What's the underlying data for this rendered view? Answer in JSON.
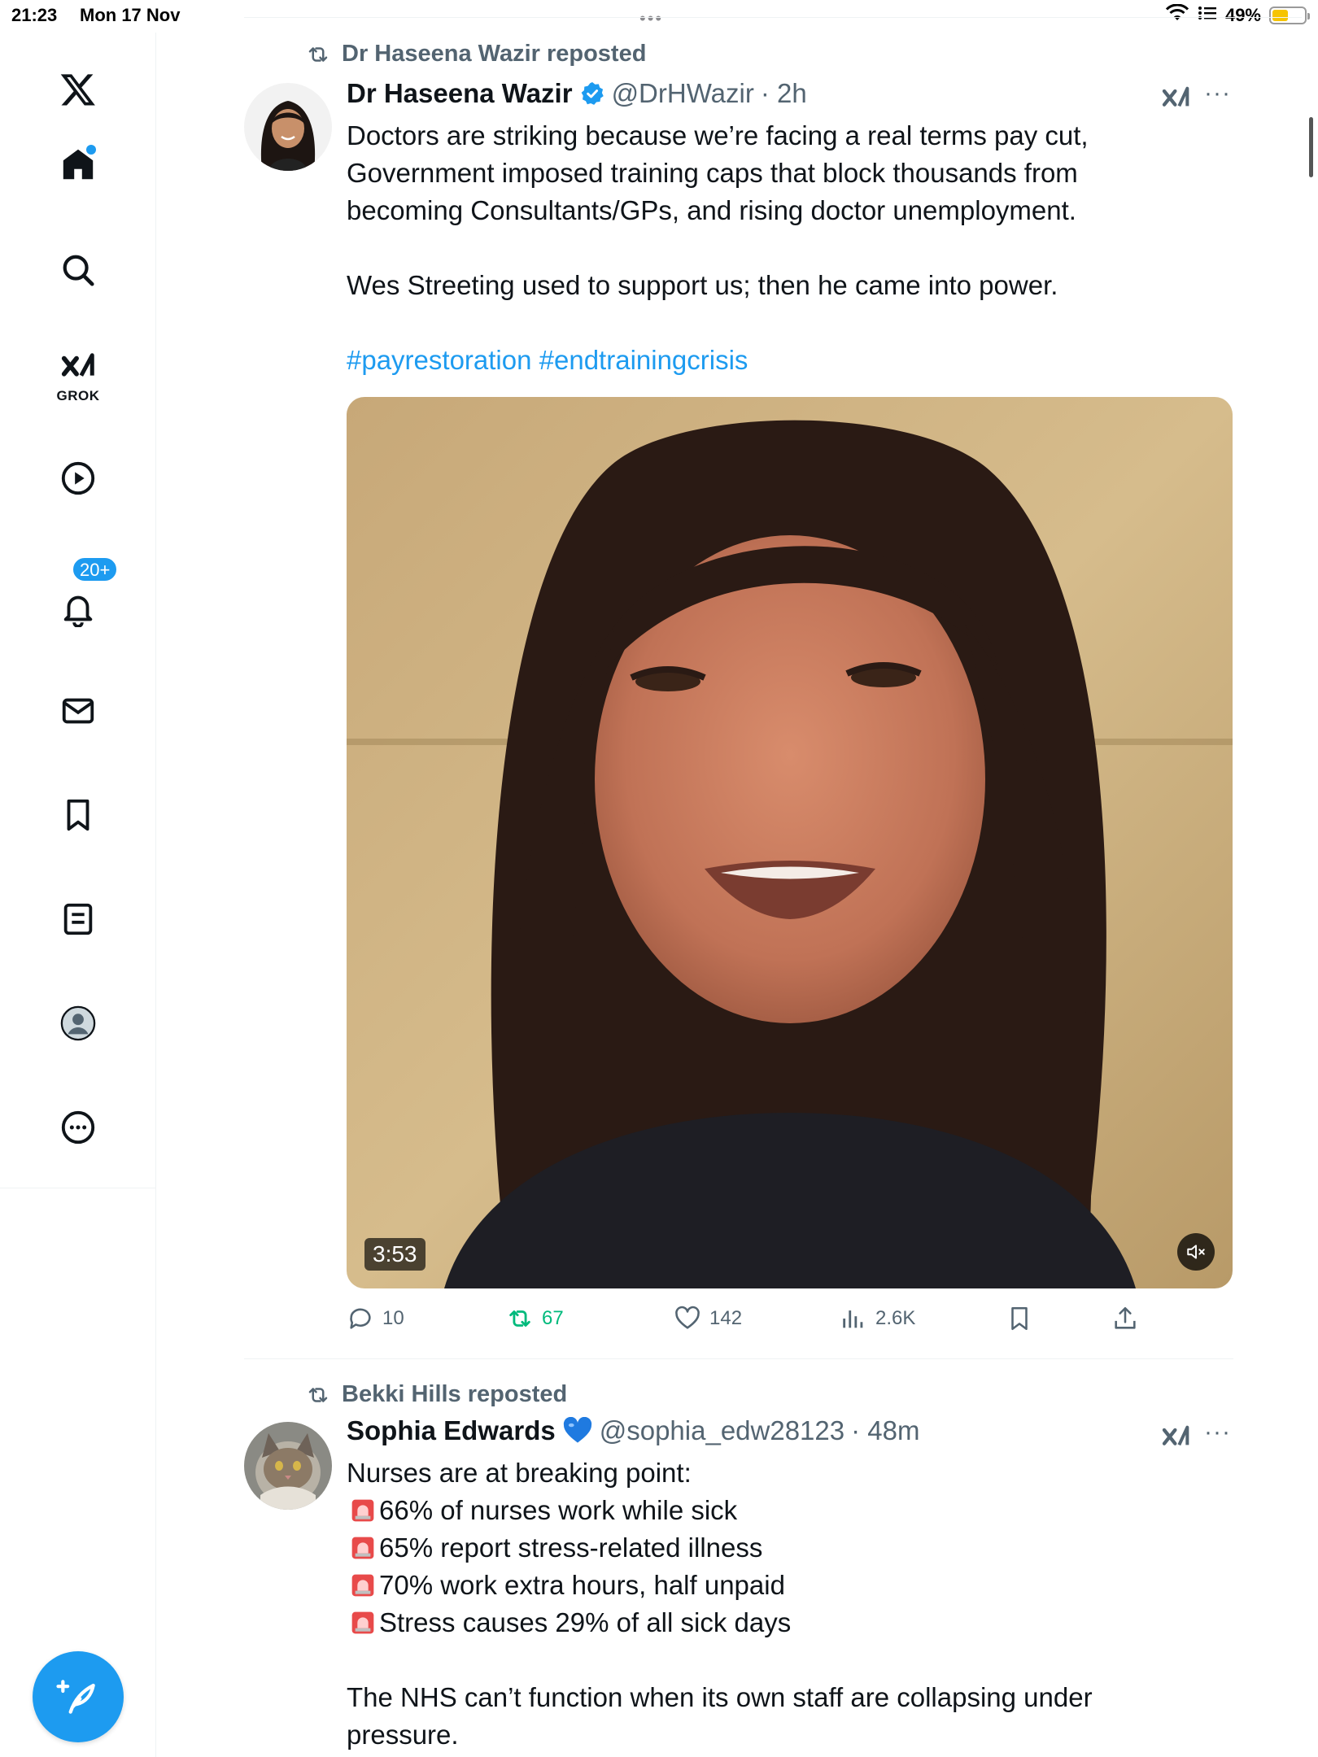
{
  "status_bar": {
    "time": "21:23",
    "date": "Mon 17 Nov",
    "battery": "49%",
    "battery_level": 0.49,
    "dots": "•••"
  },
  "sidebar": {
    "grok_label": "GROK",
    "notifications_badge": "20+",
    "items": [
      "x-logo",
      "home-icon",
      "search-icon",
      "grok-icon",
      "video-icon",
      "bell-icon",
      "mail-icon",
      "bookmark-icon",
      "lists-icon",
      "profile-icon",
      "more-icon"
    ]
  },
  "tweets": [
    {
      "repost_label": "Dr Haseena Wazir reposted",
      "display_name": "Dr Haseena Wazir",
      "handle": "@DrHWazir",
      "time": "· 2h",
      "more": "···",
      "text_lines": [
        "Doctors are striking because we’re facing a real terms pay cut, Government imposed training caps that block thousands from becoming Consultants/GPs, and rising doctor unemployment.",
        "",
        "Wes Streeting used to support us; then he came into power.",
        ""
      ],
      "hashtags": "#payrestoration #endtrainingcrisis",
      "video_duration": "3:53",
      "actions": {
        "replies": "10",
        "reposts": "67",
        "likes": "142",
        "views": "2.6K"
      }
    },
    {
      "repost_label": "Bekki Hills reposted",
      "display_name": "Sophia Edwards",
      "handle": "@sophia_edw28123",
      "time": "· 48m",
      "more": "···",
      "intro": "Nurses are at breaking point:",
      "bullets": [
        "66% of nurses work while sick",
        "65% report stress-related illness",
        "70% work extra hours, half unpaid",
        "Stress causes 29% of all sick days"
      ],
      "closing": "The NHS can’t function when its own staff are collapsing under pressure."
    }
  ],
  "colors": {
    "accent": "#1d9bf0",
    "repost_green": "#00ba7c",
    "secondary_text": "#536471",
    "primary_text": "#0f1419"
  }
}
